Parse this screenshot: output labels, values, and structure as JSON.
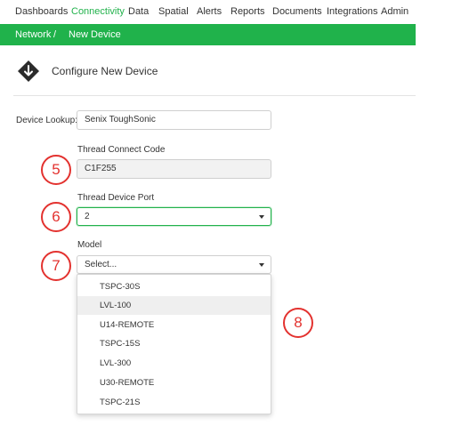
{
  "nav": {
    "items": [
      {
        "label": "Dashboards",
        "active": false
      },
      {
        "label": "Connectivity",
        "active": true
      },
      {
        "label": "Data",
        "active": false
      },
      {
        "label": "Spatial",
        "active": false
      },
      {
        "label": "Alerts",
        "active": false
      },
      {
        "label": "Reports",
        "active": false
      },
      {
        "label": "Documents",
        "active": false
      },
      {
        "label": "Integrations",
        "active": false
      },
      {
        "label": "Admin",
        "active": false
      }
    ]
  },
  "breadcrumb": {
    "root": "Network",
    "separator": "/",
    "current": "New Device"
  },
  "header": {
    "title": "Configure New Device",
    "icon": "download-arrow-icon"
  },
  "form": {
    "device_lookup": {
      "label": "Device Lookup:",
      "value": "Senix ToughSonic"
    },
    "connect_code": {
      "label": "Thread Connect Code",
      "value": "C1F255"
    },
    "device_port": {
      "label": "Thread Device Port",
      "value": "2"
    },
    "model": {
      "label": "Model",
      "value": "Select...",
      "options": [
        "TSPC-30S",
        "LVL-100",
        "U14-REMOTE",
        "TSPC-15S",
        "LVL-300",
        "U30-REMOTE",
        "TSPC-21S"
      ],
      "highlighted": "LVL-100"
    }
  },
  "callouts": [
    "5",
    "6",
    "7",
    "8"
  ],
  "colors": {
    "brand_green": "#20b24b",
    "callout_red": "#e3322f",
    "icon_dark": "#2b2b2b"
  }
}
